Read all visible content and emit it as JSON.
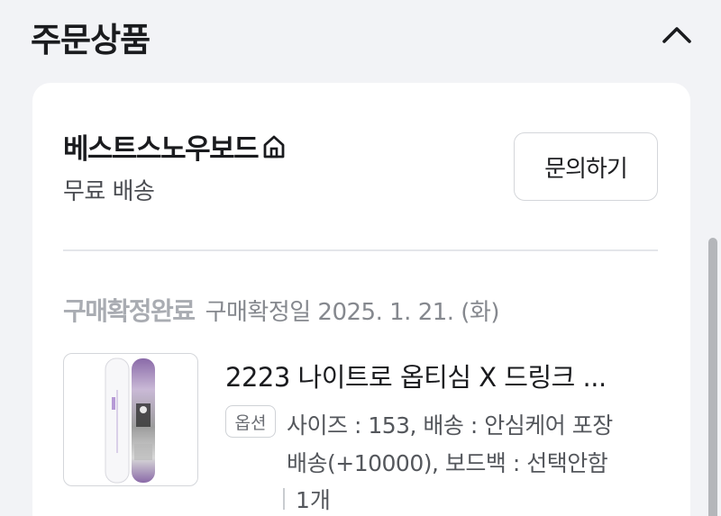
{
  "section": {
    "title": "주문상품"
  },
  "store": {
    "name": "베스트스노우보드",
    "shipping": "무료 배송",
    "inquiry_label": "문의하기"
  },
  "order": {
    "status": "구매확정완료",
    "confirm_date": "구매확정일 2025. 1. 21. (화)"
  },
  "product": {
    "title": "2223 나이트로 옵티심 X 드링크 ...",
    "option_badge": "옵션",
    "option_line1": "사이즈 : 153, 배송 : 안심케어 포장",
    "option_line2": "배송(+10000), 보드백 : 선택안함",
    "quantity": "1개"
  },
  "icons": {
    "collapse": "chevron-up-icon",
    "store_home": "home-icon"
  },
  "colors": {
    "background": "#f2f3f6",
    "card": "#ffffff",
    "status_muted": "#a9acb2",
    "board_purple": "#8a6aa8"
  }
}
